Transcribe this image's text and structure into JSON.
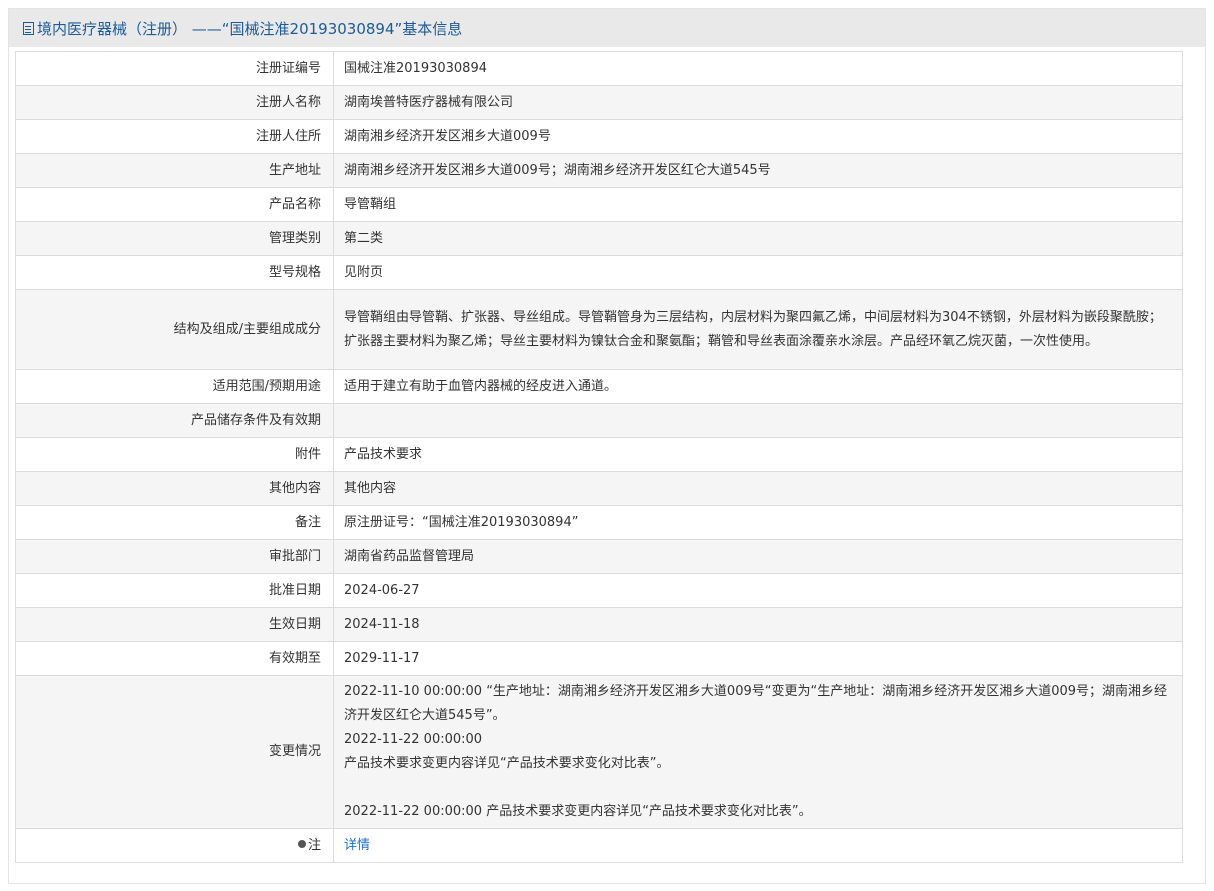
{
  "header": {
    "title": "境内医疗器械（注册） ——“国械注准20193030894”基本信息"
  },
  "rows": [
    {
      "label": "注册证编号",
      "value": "国械注准20193030894"
    },
    {
      "label": "注册人名称",
      "value": "湖南埃普特医疗器械有限公司"
    },
    {
      "label": "注册人住所",
      "value": "湖南湘乡经济开发区湘乡大道009号"
    },
    {
      "label": "生产地址",
      "value": "湖南湘乡经济开发区湘乡大道009号；湖南湘乡经济开发区红仑大道545号"
    },
    {
      "label": "产品名称",
      "value": "导管鞘组"
    },
    {
      "label": "管理类别",
      "value": "第二类"
    },
    {
      "label": "型号规格",
      "value": "见附页"
    },
    {
      "label": "结构及组成/主要组成成分",
      "value": "导管鞘组由导管鞘、扩张器、导丝组成。导管鞘管身为三层结构，内层材料为聚四氟乙烯，中间层材料为304不锈钢，外层材料为嵌段聚酰胺；扩张器主要材料为聚乙烯；导丝主要材料为镍钛合金和聚氨酯；鞘管和导丝表面涂覆亲水涂层。产品经环氧乙烷灭菌，一次性使用。"
    },
    {
      "label": "适用范围/预期用途",
      "value": "适用于建立有助于血管内器械的经皮进入通道。"
    },
    {
      "label": "产品储存条件及有效期",
      "value": ""
    },
    {
      "label": "附件",
      "value": "产品技术要求"
    },
    {
      "label": "其他内容",
      "value": "其他内容"
    },
    {
      "label": "备注",
      "value": "原注册证号：“国械注准20193030894”"
    },
    {
      "label": "审批部门",
      "value": "湖南省药品监督管理局"
    },
    {
      "label": "批准日期",
      "value": "2024-06-27"
    },
    {
      "label": "生效日期",
      "value": "2024-11-18"
    },
    {
      "label": "有效期至",
      "value": "2029-11-17"
    }
  ],
  "change": {
    "label": "变更情况",
    "line1": "2022-11-10 00:00:00 “生产地址：湖南湘乡经济开发区湘乡大道009号“变更为“生产地址：湖南湘乡经济开发区湘乡大道009号；湖南湘乡经济开发区红仑大道545号”。",
    "line2": "2022-11-22 00:00:00",
    "line3": "产品技术要求变更内容详见“产品技术要求变化对比表”。",
    "line4": "2022-11-22 00:00:00 产品技术要求变更内容详见“产品技术要求变化对比表”。"
  },
  "note": {
    "label": "注",
    "link": "详情"
  }
}
